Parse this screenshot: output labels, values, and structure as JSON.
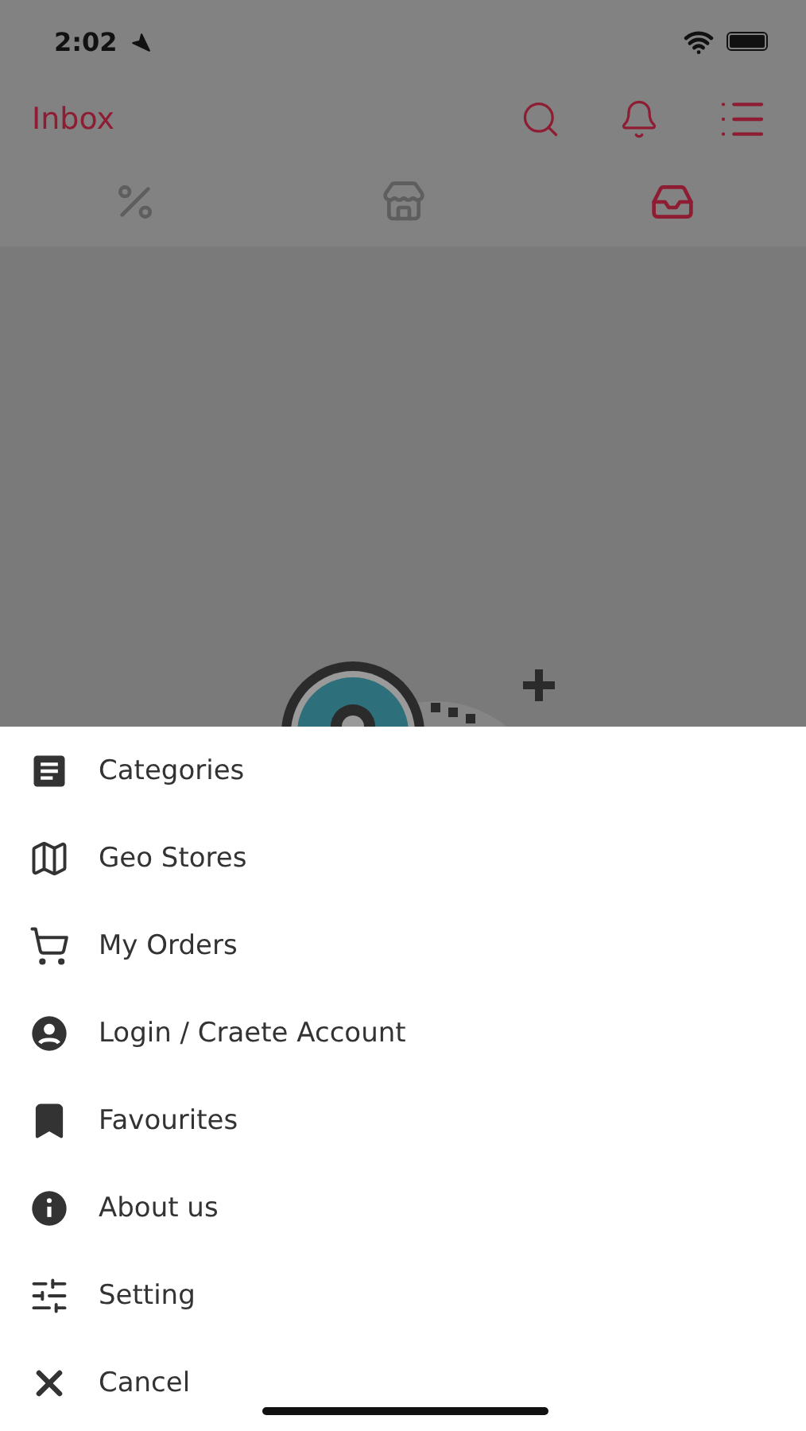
{
  "status_bar": {
    "time": "2:02"
  },
  "header": {
    "title": "Inbox"
  },
  "tabs": [
    {
      "kind": "percent",
      "selected": false
    },
    {
      "kind": "store",
      "selected": false
    },
    {
      "kind": "inbox",
      "selected": true
    }
  ],
  "menu": [
    {
      "kind": "categories",
      "label": "Categories"
    },
    {
      "kind": "map",
      "label": "Geo Stores"
    },
    {
      "kind": "cart",
      "label": "My Orders"
    },
    {
      "kind": "account",
      "label": "Login / Craete Account"
    },
    {
      "kind": "bookmark",
      "label": "Favourites"
    },
    {
      "kind": "info",
      "label": "About us"
    },
    {
      "kind": "settings",
      "label": "Setting"
    },
    {
      "kind": "cancel",
      "label": "Cancel"
    }
  ]
}
